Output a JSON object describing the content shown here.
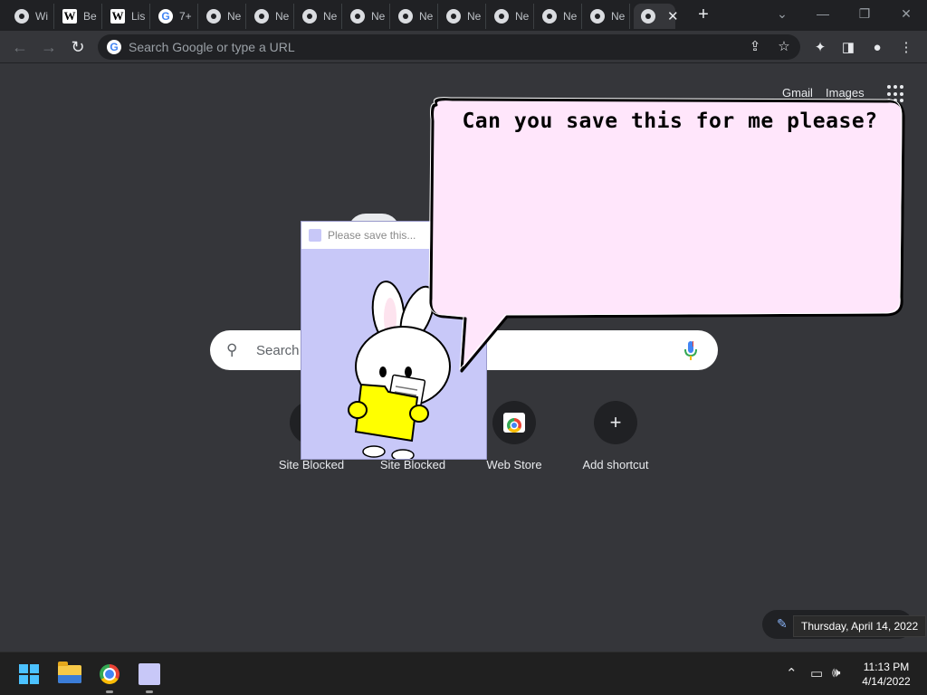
{
  "browser": {
    "tabs": [
      {
        "icon": "chrome-icon",
        "label": "Wi"
      },
      {
        "icon": "wikipedia-icon",
        "label": "Be"
      },
      {
        "icon": "wikipedia-icon",
        "label": "Lis"
      },
      {
        "icon": "google-icon",
        "label": "7+"
      },
      {
        "icon": "chrome-icon",
        "label": "Ne"
      },
      {
        "icon": "chrome-icon",
        "label": "Ne"
      },
      {
        "icon": "chrome-icon",
        "label": "Ne"
      },
      {
        "icon": "chrome-icon",
        "label": "Ne"
      },
      {
        "icon": "chrome-icon",
        "label": "Ne"
      },
      {
        "icon": "chrome-icon",
        "label": "Ne"
      },
      {
        "icon": "chrome-icon",
        "label": "Ne"
      },
      {
        "icon": "chrome-icon",
        "label": "Ne"
      },
      {
        "icon": "chrome-icon",
        "label": "Ne"
      }
    ],
    "new_tab_symbol": "+",
    "omnibox_placeholder": "Search Google or type a URL"
  },
  "ntp": {
    "gmail": "Gmail",
    "images": "Images",
    "search_placeholder": "Search",
    "shortcuts": [
      {
        "label": "Site Blocked",
        "icon": "blocked-site-icon"
      },
      {
        "label": "Site Blocked",
        "icon": "blocked-site-icon"
      },
      {
        "label": "Web Store",
        "icon": "web-store-icon"
      },
      {
        "label": "Add shortcut",
        "icon": "plus-icon",
        "symbol": "+"
      }
    ],
    "date_tooltip": "Thursday, April 14, 2022"
  },
  "popup": {
    "title": "Please save this..."
  },
  "bubble": {
    "text": "Can you save this for me please?"
  },
  "taskbar": {
    "time": "11:13 PM",
    "date": "4/14/2022"
  },
  "colors": {
    "bubble_fill": "#ffe6fb",
    "popup_bg": "#c8c8f8",
    "folder_yellow": "#ffff00"
  }
}
